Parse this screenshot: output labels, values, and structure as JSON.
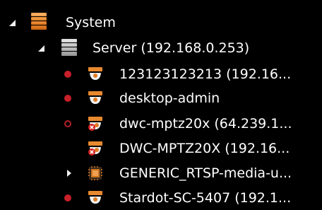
{
  "tree": {
    "system": {
      "label": "System",
      "expanded": true,
      "icon": "system-stack-icon"
    },
    "server": {
      "label": "Server (192.168.0.253)",
      "expanded": true,
      "icon": "server-stack-icon"
    },
    "devices": [
      {
        "label": "123123123213 (192.16...",
        "status": "recording",
        "icon": "dome-camera-icon"
      },
      {
        "label": "desktop-admin",
        "status": "recording",
        "icon": "dome-camera-icon"
      },
      {
        "label": "dwc-mptz20x (64.239.1...",
        "status": "not-recording",
        "icon": "dome-camera-error-icon"
      },
      {
        "label": "DWC-MPTZ20X (192.16...",
        "status": "none",
        "icon": "dome-camera-error-icon"
      },
      {
        "label": "GENERIC_RTSP-media-u...",
        "status": "collapsed",
        "icon": "chip-icon"
      },
      {
        "label": "Stardot-SC-5407 (192.1...",
        "status": "recording",
        "icon": "dome-camera-icon"
      }
    ]
  },
  "colors": {
    "background": "#000000",
    "text": "#ffffff",
    "status_red": "#c8202a",
    "camera_orange": "#e07a22",
    "camera_white": "#f2f2f2",
    "error_red": "#d42020",
    "stack_orange": "#e8892f",
    "stack_gray": "#b8b8b8"
  }
}
